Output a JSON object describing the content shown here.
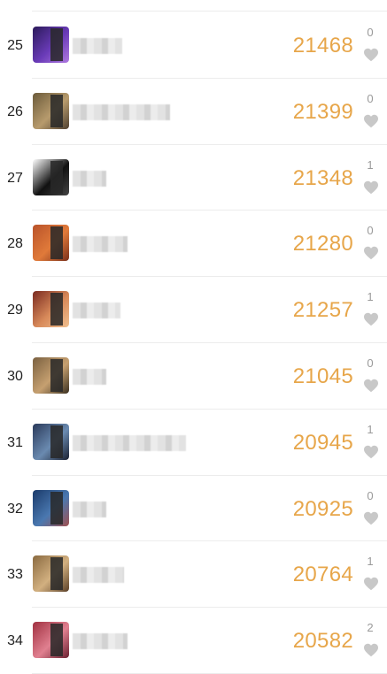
{
  "rows": [
    {
      "rank": "25",
      "score": "21468",
      "likes": "0",
      "avatar": [
        "#2b1a5a",
        "#6a3bb8",
        "#b07ae0"
      ],
      "name_w": 56
    },
    {
      "rank": "26",
      "score": "21399",
      "likes": "0",
      "avatar": [
        "#6b5a3a",
        "#b79b6d",
        "#4f4030"
      ],
      "name_w": 110
    },
    {
      "rank": "27",
      "score": "21348",
      "likes": "1",
      "avatar": [
        "#ffffff",
        "#111111",
        "#444444"
      ],
      "name_w": 38
    },
    {
      "rank": "28",
      "score": "21280",
      "likes": "0",
      "avatar": [
        "#b9532a",
        "#e07a3a",
        "#7a2f1a"
      ],
      "name_w": 62
    },
    {
      "rank": "29",
      "score": "21257",
      "likes": "1",
      "avatar": [
        "#7a2a20",
        "#d88a5a",
        "#f0c090"
      ],
      "name_w": 54
    },
    {
      "rank": "30",
      "score": "21045",
      "likes": "0",
      "avatar": [
        "#7a6040",
        "#c6a070",
        "#3a3020"
      ],
      "name_w": 38
    },
    {
      "rank": "31",
      "score": "20945",
      "likes": "1",
      "avatar": [
        "#2a3a5a",
        "#6a8ab0",
        "#1a2030"
      ],
      "name_w": 128
    },
    {
      "rank": "32",
      "score": "20925",
      "likes": "0",
      "avatar": [
        "#1a3a6a",
        "#4a78b0",
        "#a05050"
      ],
      "name_w": 38
    },
    {
      "rank": "33",
      "score": "20764",
      "likes": "1",
      "avatar": [
        "#8a6a40",
        "#d2b080",
        "#5a4028"
      ],
      "name_w": 58
    },
    {
      "rank": "34",
      "score": "20582",
      "likes": "2",
      "avatar": [
        "#a03040",
        "#e08090",
        "#6a2030"
      ],
      "name_w": 62
    }
  ],
  "colors": {
    "score": "#e7a64a",
    "heart": "#c8c8c8",
    "likes": "#9a9a9a"
  },
  "icons": {
    "like": "heart-icon"
  }
}
